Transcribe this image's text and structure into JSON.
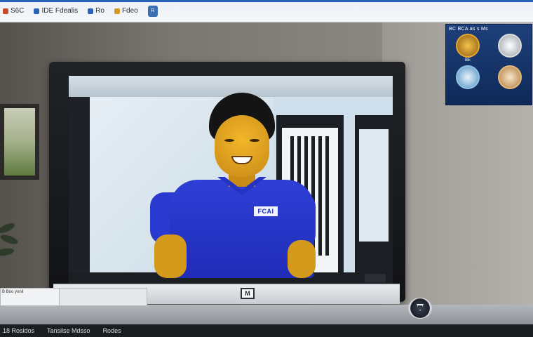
{
  "topbar": {
    "items": [
      {
        "label": "S6C",
        "color": "#c84a2a",
        "icon": "logo-icon"
      },
      {
        "label": "IDE  Fdealis",
        "color": "#2a62b8",
        "icon": "logo-icon"
      },
      {
        "label": "Ro",
        "color": "#2a62b8",
        "icon": "logo-icon"
      },
      {
        "label": "Fdeo",
        "color": "#d39a25",
        "icon": "logo-icon"
      }
    ],
    "badge": "R"
  },
  "poster": {
    "title": "BC  BCA  as s Ms",
    "cells": [
      {
        "label": "BE",
        "disc_color": "#e7a72e"
      },
      {
        "label": "",
        "disc_color": "#dcdcdc"
      },
      {
        "label": "",
        "disc_color": "#8fc3e8"
      },
      {
        "label": "",
        "disc_color": "#e6b97a"
      }
    ]
  },
  "screen": {
    "shirt_logo": "FCAI"
  },
  "monitor": {
    "brand_mark": "M"
  },
  "sticker": {
    "text": "B  Boo  yonil"
  },
  "bottombar": {
    "items": [
      "18 Rosidos",
      "Tansilse Mdsso",
      "Rodes"
    ]
  },
  "colors": {
    "shirt": "#1f2cb8",
    "skin": "#d39a1c",
    "poster_bg": "#0f2a58",
    "topbar_accent": "#2a62b8"
  }
}
